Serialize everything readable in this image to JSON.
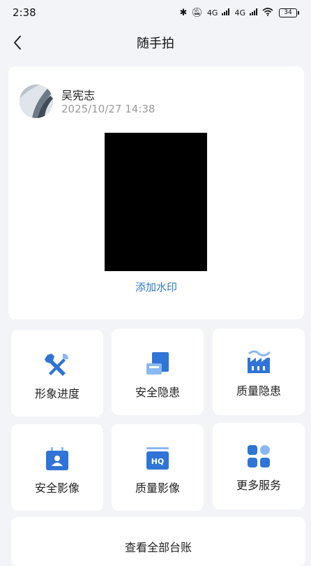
{
  "status_bar": {
    "time": "2:38",
    "network_1": "4G",
    "network_2": "4G",
    "battery": "34"
  },
  "header": {
    "title": "随手拍",
    "back_icon": "chevron-left-icon"
  },
  "post": {
    "user_name": "吴宪志",
    "timestamp": "2025/10/27 14:38",
    "add_watermark_label": "添加水印"
  },
  "tiles": [
    {
      "label": "形象进度",
      "icon": "tools-icon"
    },
    {
      "label": "安全隐患",
      "icon": "hazard-panel-icon"
    },
    {
      "label": "质量隐患",
      "icon": "factory-icon"
    },
    {
      "label": "安全影像",
      "icon": "id-card-icon"
    },
    {
      "label": "质量影像",
      "icon": "hq-monitor-icon"
    },
    {
      "label": "更多服务",
      "icon": "apps-grid-icon"
    }
  ],
  "footer": {
    "view_all_label": "查看全部台账"
  },
  "colors": {
    "accent_blue": "#2f74d6",
    "light_blue": "#8ab8f2",
    "link_blue": "#2f7cc8",
    "page_bg": "#f3f4f8"
  }
}
